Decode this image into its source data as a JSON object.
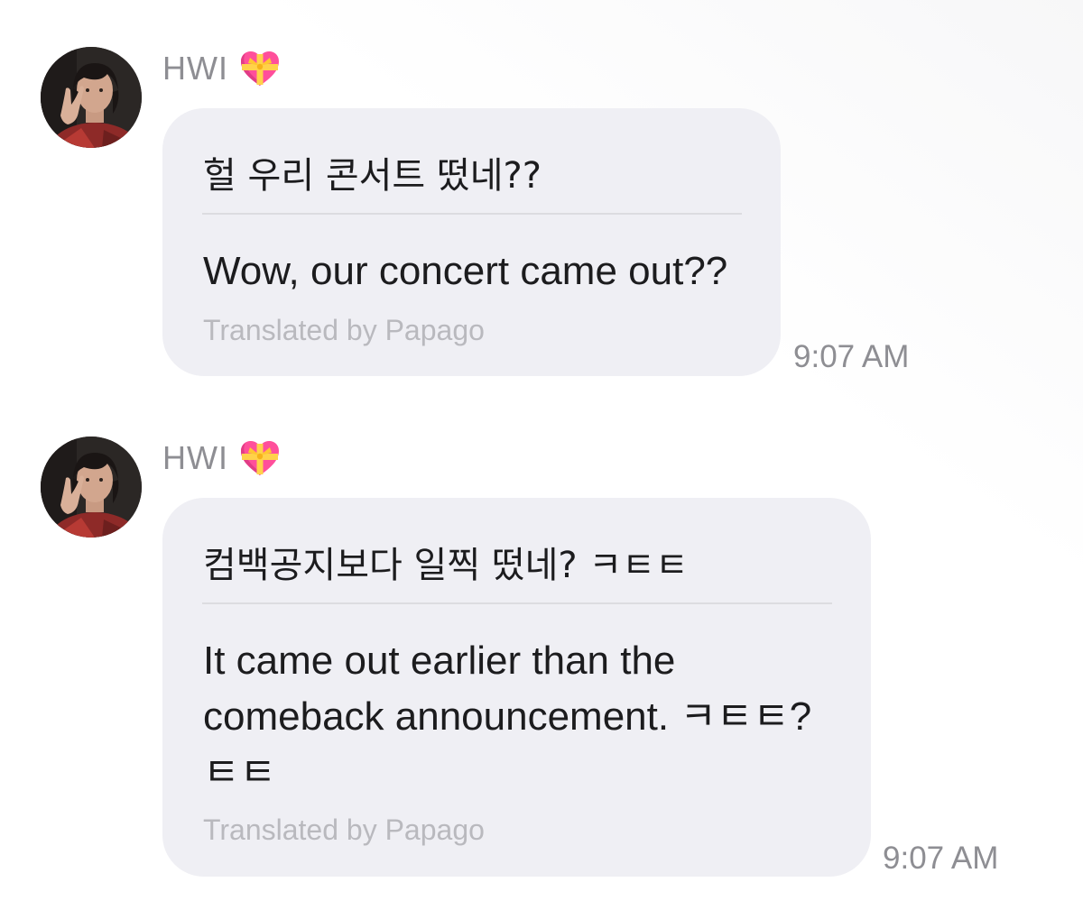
{
  "messages": [
    {
      "sender": "HWI",
      "sender_badge_icon": "gift-heart-icon",
      "original_text": "헐 우리 콘서트 떴네??",
      "translated_text": "Wow, our concert came out??",
      "translation_credit": "Translated by Papago",
      "time": "9:07 AM"
    },
    {
      "sender": "HWI",
      "sender_badge_icon": "gift-heart-icon",
      "original_text": "컴백공지보다 일찍 떴네? ㅋㅌㅌ",
      "translated_text": "It came out earlier than the comeback announcement. ㅋㅌㅌ? ㅌㅌ",
      "translation_credit": "Translated by Papago",
      "time": "9:07 AM"
    }
  ],
  "colors": {
    "bubble_bg": "#efeff4",
    "text": "#1c1c1e",
    "secondary_text": "#8e8e93",
    "credit_text": "#b9b9be",
    "divider": "#dcdce0"
  }
}
